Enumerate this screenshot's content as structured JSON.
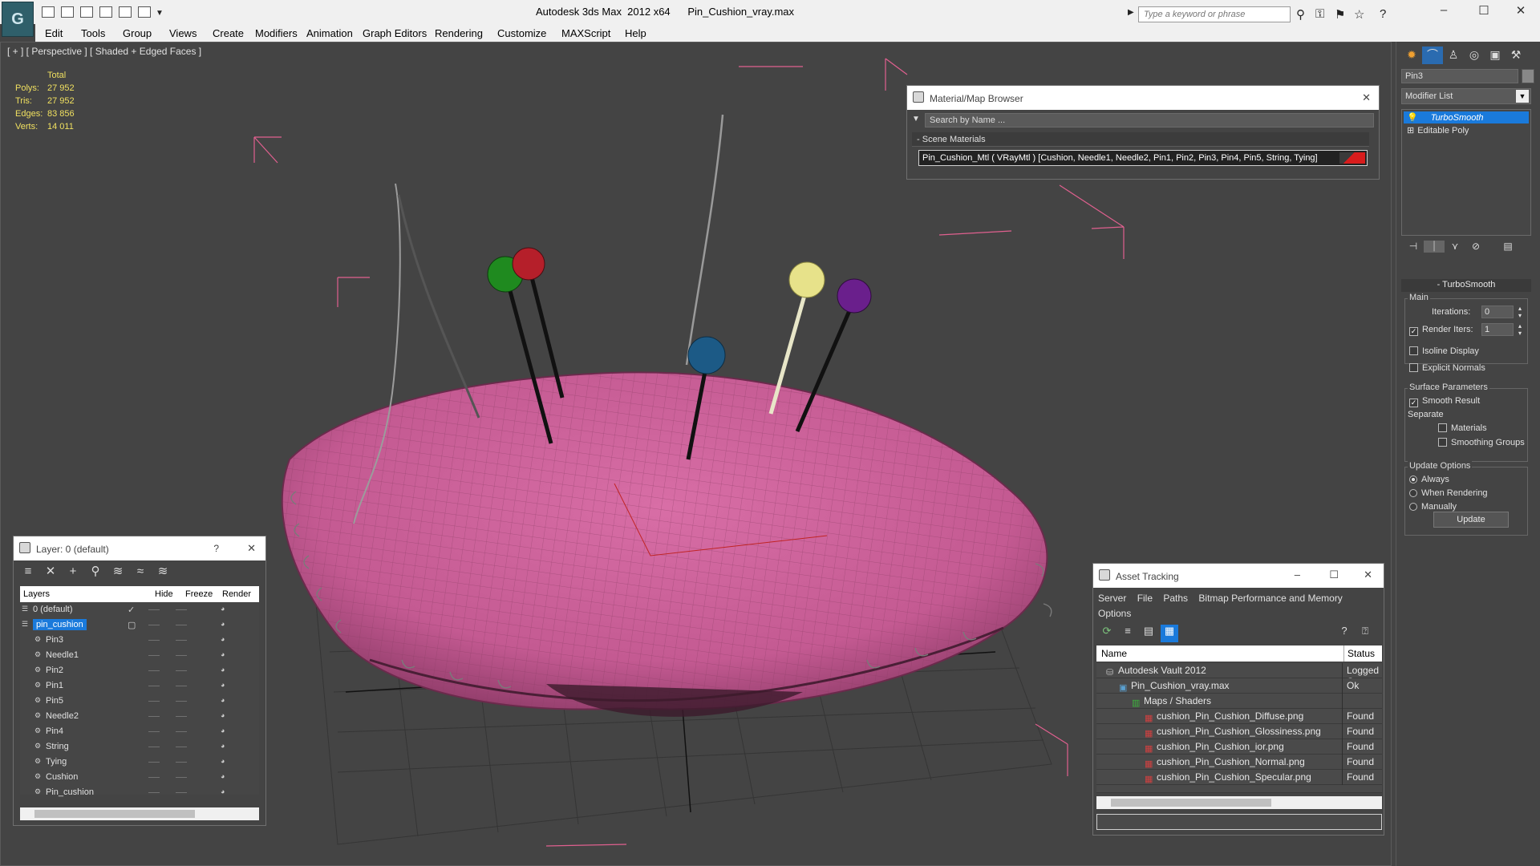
{
  "app": {
    "title": "Autodesk 3ds Max  2012 x64      Pin_Cushion_vray.max",
    "search_placeholder": "Type a keyword or phrase",
    "logo_glyph": "G"
  },
  "menu": [
    "Edit",
    "Tools",
    "Group",
    "Views",
    "Create",
    "Modifiers",
    "Animation",
    "Graph Editors",
    "Rendering",
    "Customize",
    "MAXScript",
    "Help"
  ],
  "viewport": {
    "label": "[ + ] [ Perspective ] [ Shaded + Edged Faces ]",
    "stats": {
      "total_label": "Total",
      "rows": [
        {
          "label": "Polys:",
          "value": "27 952"
        },
        {
          "label": "Tris:",
          "value": "27 952"
        },
        {
          "label": "Edges:",
          "value": "83 856"
        },
        {
          "label": "Verts:",
          "value": "14 011"
        }
      ]
    }
  },
  "layer_window": {
    "title": "Layer: 0 (default)",
    "help": "?",
    "close": "✕",
    "columns": [
      "Layers",
      "Hide",
      "Freeze",
      "Render"
    ],
    "rows": [
      {
        "name": "0 (default)",
        "kind": "layer",
        "check": "✓"
      },
      {
        "name": "pin_cushion",
        "kind": "layer",
        "selected": true
      },
      {
        "name": "Pin3",
        "kind": "object"
      },
      {
        "name": "Needle1",
        "kind": "object"
      },
      {
        "name": "Pin2",
        "kind": "object"
      },
      {
        "name": "Pin1",
        "kind": "object"
      },
      {
        "name": "Pin5",
        "kind": "object"
      },
      {
        "name": "Needle2",
        "kind": "object"
      },
      {
        "name": "Pin4",
        "kind": "object"
      },
      {
        "name": "String",
        "kind": "object"
      },
      {
        "name": "Tying",
        "kind": "object"
      },
      {
        "name": "Cushion",
        "kind": "object"
      },
      {
        "name": "Pin_cushion",
        "kind": "object"
      }
    ]
  },
  "material_browser": {
    "title": "Material/Map Browser",
    "search_placeholder": "Search by Name ...",
    "section": "Scene Materials",
    "item": "Pin_Cushion_Mtl  ( VRayMtl )  [Cushion, Needle1, Needle2, Pin1, Pin2, Pin3, Pin4, Pin5, String, Tying]",
    "close": "✕"
  },
  "asset_tracking": {
    "title": "Asset Tracking",
    "menu": [
      "Server",
      "File",
      "Paths",
      "Bitmap Performance and Memory",
      "Options"
    ],
    "columns": [
      "Name",
      "Status"
    ],
    "rows": [
      {
        "name": "Autodesk Vault 2012",
        "status": "Logged O",
        "indent": 1,
        "icon": "vault-icon"
      },
      {
        "name": "Pin_Cushion_vray.max",
        "status": "Ok",
        "indent": 2,
        "icon": "max-file-icon"
      },
      {
        "name": "Maps / Shaders",
        "status": "",
        "indent": 3,
        "icon": "maps-folder-icon"
      },
      {
        "name": "cushion_Pin_Cushion_Diffuse.png",
        "status": "Found",
        "indent": 4,
        "icon": "png-icon"
      },
      {
        "name": "cushion_Pin_Cushion_Glossiness.png",
        "status": "Found",
        "indent": 4,
        "icon": "png-icon"
      },
      {
        "name": "cushion_Pin_Cushion_ior.png",
        "status": "Found",
        "indent": 4,
        "icon": "png-icon"
      },
      {
        "name": "cushion_Pin_Cushion_Normal.png",
        "status": "Found",
        "indent": 4,
        "icon": "png-icon"
      },
      {
        "name": "cushion_Pin_Cushion_Specular.png",
        "status": "Found",
        "indent": 4,
        "icon": "png-icon"
      }
    ]
  },
  "command_panel": {
    "object_name": "Pin3",
    "modifier_list": "Modifier List",
    "stack": [
      "TurboSmooth",
      "Editable Poly"
    ],
    "rollout": "TurboSmooth",
    "main_group": "Main",
    "iterations_label": "Iterations:",
    "iterations_value": "0",
    "render_iters_label": "Render Iters:",
    "render_iters_value": "1",
    "isoline": "Isoline Display",
    "explicit_normals": "Explicit Normals",
    "surface_group": "Surface Parameters",
    "smooth_result": "Smooth Result",
    "separate": "Separate",
    "materials": "Materials",
    "smoothing_groups": "Smoothing Groups",
    "update_group": "Update Options",
    "always": "Always",
    "when_rendering": "When Rendering",
    "manually": "Manually",
    "update_button": "Update"
  },
  "colors": {
    "cushion": "#cc5f98",
    "wire": "#e07aa6",
    "pin_green": "#1f8a1f",
    "pin_red": "#b51f2a",
    "pin_blue": "#1c5a86",
    "pin_yellow": "#e7e28a",
    "pin_purple": "#6a1f8c",
    "selection": "#1a7adb"
  }
}
